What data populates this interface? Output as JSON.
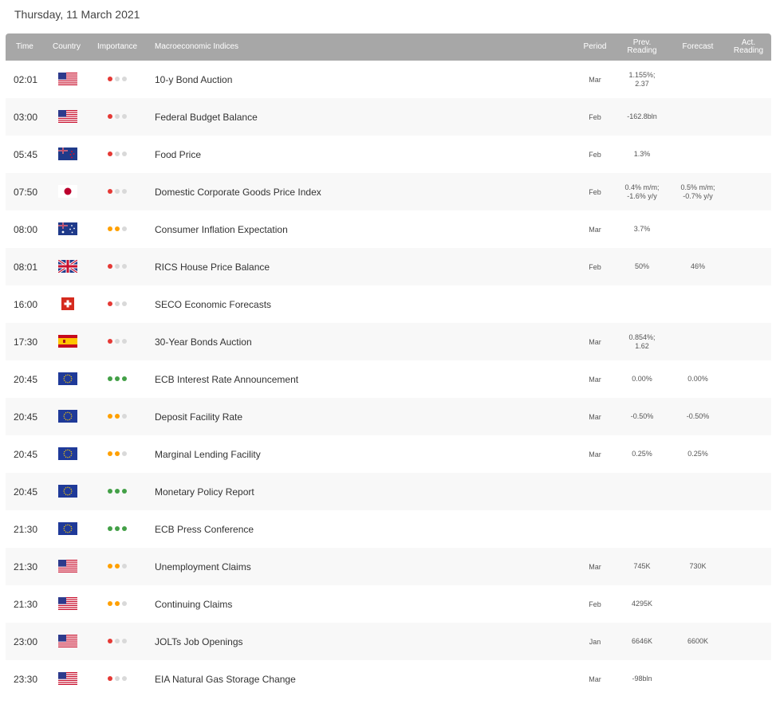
{
  "date_title": "Thursday, 11 March 2021",
  "headers": {
    "time": "Time",
    "country": "Country",
    "importance": "Importance",
    "indices": "Macroeconomic Indices",
    "period": "Period",
    "prev": "Prev. Reading",
    "forecast": "Forecast",
    "actual": "Act. Reading"
  },
  "colors": {
    "high": "#e53935",
    "medium": "#ffa000",
    "low_green": "#43a047",
    "inactive": "#d9d9d9"
  },
  "rows": [
    {
      "time": "02:01",
      "country": "us-flag",
      "importance": "low",
      "name": "10-y Bond Auction",
      "period": "Mar",
      "prev": "1.155%;\n2.37",
      "forecast": "",
      "actual": ""
    },
    {
      "time": "03:00",
      "country": "us-flag",
      "importance": "low",
      "name": "Federal Budget Balance",
      "period": "Feb",
      "prev": "-162.8bln",
      "forecast": "",
      "actual": ""
    },
    {
      "time": "05:45",
      "country": "nz-flag",
      "importance": "low",
      "name": "Food Price",
      "period": "Feb",
      "prev": "1.3%",
      "forecast": "",
      "actual": ""
    },
    {
      "time": "07:50",
      "country": "jp-flag",
      "importance": "low",
      "name": "Domestic Corporate Goods Price Index",
      "period": "Feb",
      "prev": "0.4% m/m;\n-1.6% y/y",
      "forecast": "0.5% m/m;\n-0.7% y/y",
      "actual": ""
    },
    {
      "time": "08:00",
      "country": "au-flag",
      "importance": "medium",
      "name": "Consumer Inflation Expectation",
      "period": "Mar",
      "prev": "3.7%",
      "forecast": "",
      "actual": ""
    },
    {
      "time": "08:01",
      "country": "gb-flag",
      "importance": "low",
      "name": "RICS House Price Balance",
      "period": "Feb",
      "prev": "50%",
      "forecast": "46%",
      "actual": ""
    },
    {
      "time": "16:00",
      "country": "ch-flag",
      "importance": "low",
      "name": "SECO Economic Forecasts",
      "period": "",
      "prev": "",
      "forecast": "",
      "actual": ""
    },
    {
      "time": "17:30",
      "country": "es-flag",
      "importance": "low",
      "name": "30-Year Bonds Auction",
      "period": "Mar",
      "prev": "0.854%;\n1.62",
      "forecast": "",
      "actual": ""
    },
    {
      "time": "20:45",
      "country": "eu-flag",
      "importance": "high",
      "name": "ECB Interest Rate Announcement",
      "period": "Mar",
      "prev": "0.00%",
      "forecast": "0.00%",
      "actual": ""
    },
    {
      "time": "20:45",
      "country": "eu-flag",
      "importance": "medium",
      "name": "Deposit Facility Rate",
      "period": "Mar",
      "prev": "-0.50%",
      "forecast": "-0.50%",
      "actual": ""
    },
    {
      "time": "20:45",
      "country": "eu-flag",
      "importance": "medium",
      "name": "Marginal Lending Facility",
      "period": "Mar",
      "prev": "0.25%",
      "forecast": "0.25%",
      "actual": ""
    },
    {
      "time": "20:45",
      "country": "eu-flag",
      "importance": "high",
      "name": "Monetary Policy Report",
      "period": "",
      "prev": "",
      "forecast": "",
      "actual": ""
    },
    {
      "time": "21:30",
      "country": "eu-flag",
      "importance": "high",
      "name": "ECB Press Conference",
      "period": "",
      "prev": "",
      "forecast": "",
      "actual": ""
    },
    {
      "time": "21:30",
      "country": "us-flag",
      "importance": "medium",
      "name": "Unemployment Claims",
      "period": "Mar",
      "prev": "745K",
      "forecast": "730K",
      "actual": ""
    },
    {
      "time": "21:30",
      "country": "us-flag",
      "importance": "medium",
      "name": "Continuing Claims",
      "period": "Feb",
      "prev": "4295K",
      "forecast": "",
      "actual": ""
    },
    {
      "time": "23:00",
      "country": "us-flag",
      "importance": "low",
      "name": "JOLTs Job Openings",
      "period": "Jan",
      "prev": "6646K",
      "forecast": "6600K",
      "actual": ""
    },
    {
      "time": "23:30",
      "country": "us-flag",
      "importance": "low",
      "name": "EIA Natural Gas Storage Change",
      "period": "Mar",
      "prev": "-98bln",
      "forecast": "",
      "actual": ""
    }
  ]
}
